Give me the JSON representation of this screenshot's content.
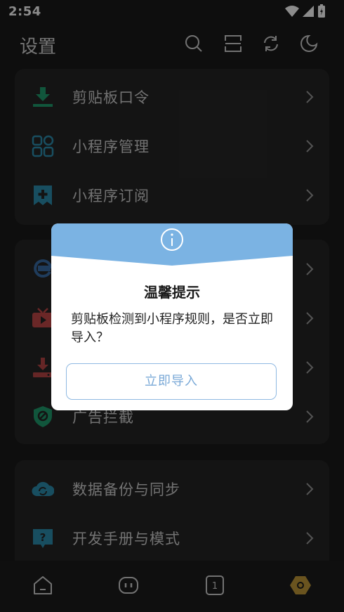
{
  "status_bar": {
    "time": "2:54",
    "icons": [
      "wifi-icon",
      "signal-icon",
      "battery-icon"
    ]
  },
  "header": {
    "title": "设置",
    "actions": [
      "search-icon",
      "layout-icon",
      "sync-icon",
      "night-mode-icon"
    ]
  },
  "sections": [
    {
      "items": [
        {
          "label": "剪贴板口令",
          "icon": "download-tray-icon",
          "color": "#1f9d6e"
        },
        {
          "label": "小程序管理",
          "icon": "grid-apps-icon",
          "color": "#2d8fb0"
        },
        {
          "label": "小程序订阅",
          "icon": "bookmark-plus-icon",
          "color": "#2d8fb0"
        }
      ]
    },
    {
      "items": [
        {
          "label": "",
          "icon": "ie-browser-icon",
          "color": "#3a6ea8"
        },
        {
          "label": "",
          "icon": "tv-play-icon",
          "color": "#c24848"
        },
        {
          "label": "",
          "icon": "download-icon",
          "color": "#b84646"
        },
        {
          "label": "广告拦截",
          "icon": "shield-block-icon",
          "color": "#1f9d6e"
        }
      ]
    },
    {
      "items": [
        {
          "label": "数据备份与同步",
          "icon": "cloud-sync-icon",
          "color": "#2d8fb0"
        },
        {
          "label": "开发手册与模式",
          "icon": "help-bubble-icon",
          "color": "#2d8fb0"
        }
      ]
    }
  ],
  "dialog": {
    "icon": "info-icon",
    "title": "温馨提示",
    "message": "剪贴板检测到小程序规则，是否立即导入？",
    "button_label": "立即导入",
    "accent": "#7bb3e3"
  },
  "bottom_nav": {
    "items": [
      "home-icon",
      "bot-icon",
      "tab-count-icon",
      "settings-hex-icon"
    ],
    "tab_count": "1",
    "active_color": "#c29a3a"
  }
}
